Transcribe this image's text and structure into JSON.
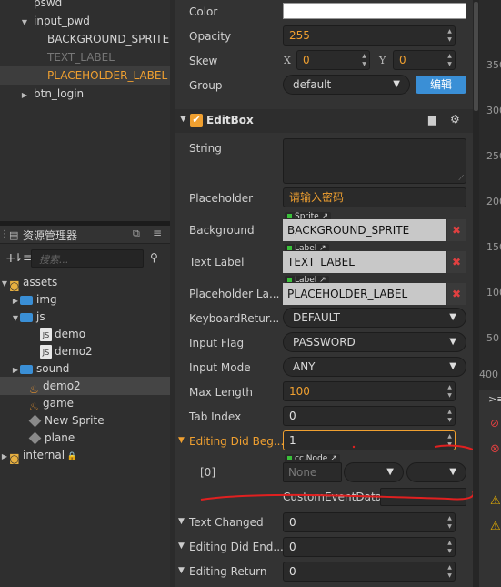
{
  "hierarchy": {
    "items": [
      {
        "label": "pswd",
        "indent": 37,
        "tri": "",
        "color": "#d6d6d6"
      },
      {
        "label": "input_pwd",
        "indent": 37,
        "tri": "▼",
        "color": "#d6d6d6"
      },
      {
        "label": "BACKGROUND_SPRITE",
        "indent": 52,
        "tri": "",
        "color": "#d6d6d6"
      },
      {
        "label": "TEXT_LABEL",
        "indent": 52,
        "tri": "",
        "color": "#777777"
      },
      {
        "label": "PLACEHOLDER_LABEL",
        "indent": 52,
        "tri": "",
        "color": "#f0a030"
      },
      {
        "label": "btn_login",
        "indent": 37,
        "tri": "▶",
        "color": "#d6d6d6"
      }
    ]
  },
  "assets": {
    "title": "资源管理器",
    "search_placeholder": "搜索...",
    "items": [
      {
        "label": "assets",
        "kind": "root"
      },
      {
        "label": "img",
        "kind": "folder"
      },
      {
        "label": "js",
        "kind": "folder-open"
      },
      {
        "label": "demo",
        "kind": "js"
      },
      {
        "label": "demo2",
        "kind": "js"
      },
      {
        "label": "sound",
        "kind": "folder"
      },
      {
        "label": "demo2",
        "kind": "scene"
      },
      {
        "label": "game",
        "kind": "scene"
      },
      {
        "label": "New Sprite",
        "kind": "prefab"
      },
      {
        "label": "plane",
        "kind": "prefab"
      },
      {
        "label": "internal",
        "kind": "root-locked"
      }
    ]
  },
  "inspector": {
    "color_label": "Color",
    "opacity_label": "Opacity",
    "opacity_value": "255",
    "skew_label": "Skew",
    "skew_x_label": "X",
    "skew_x": "0",
    "skew_y_label": "Y",
    "skew_y": "0",
    "group_label": "Group",
    "group_value": "default",
    "edit_button": "编辑",
    "component_title": "EditBox",
    "string_label": "String",
    "placeholder_label": "Placeholder",
    "placeholder_value": "请输入密码",
    "background_label": "Background",
    "background_tag": "Sprite",
    "background_value": "BACKGROUND_SPRITE",
    "textlabel_label": "Text Label",
    "textlabel_tag": "Label",
    "textlabel_value": "TEXT_LABEL",
    "placeholderlabel_label": "Placeholder La...",
    "placeholderlabel_tag": "Label",
    "placeholderlabel_value": "PLACEHOLDER_LABEL",
    "keyboard_label": "KeyboardRetur...",
    "keyboard_value": "DEFAULT",
    "inputflag_label": "Input Flag",
    "inputflag_value": "PASSWORD",
    "inputmode_label": "Input Mode",
    "inputmode_value": "ANY",
    "maxlength_label": "Max Length",
    "maxlength_value": "100",
    "tabindex_label": "Tab Index",
    "tabindex_value": "0",
    "editingbegan_label": "Editing Did Beg...",
    "editingbegan_value": "1",
    "event_index": "[0]",
    "event_tag": "cc.Node",
    "event_node": "None",
    "custom_event_label": "CustomEventData",
    "textchanged_label": "Text Changed",
    "textchanged_value": "0",
    "editingended_label": "Editing Did End...",
    "editingended_value": "0",
    "editingreturn_label": "Editing Return",
    "editingreturn_value": "0"
  },
  "ruler": {
    "ticks": [
      "350",
      "300",
      "250",
      "200",
      "150",
      "100",
      "50",
      "400"
    ]
  },
  "colors": {
    "accent": "#f0a030",
    "button": "#3a8fd6",
    "danger": "#e04040",
    "annotation": "#e02020"
  }
}
